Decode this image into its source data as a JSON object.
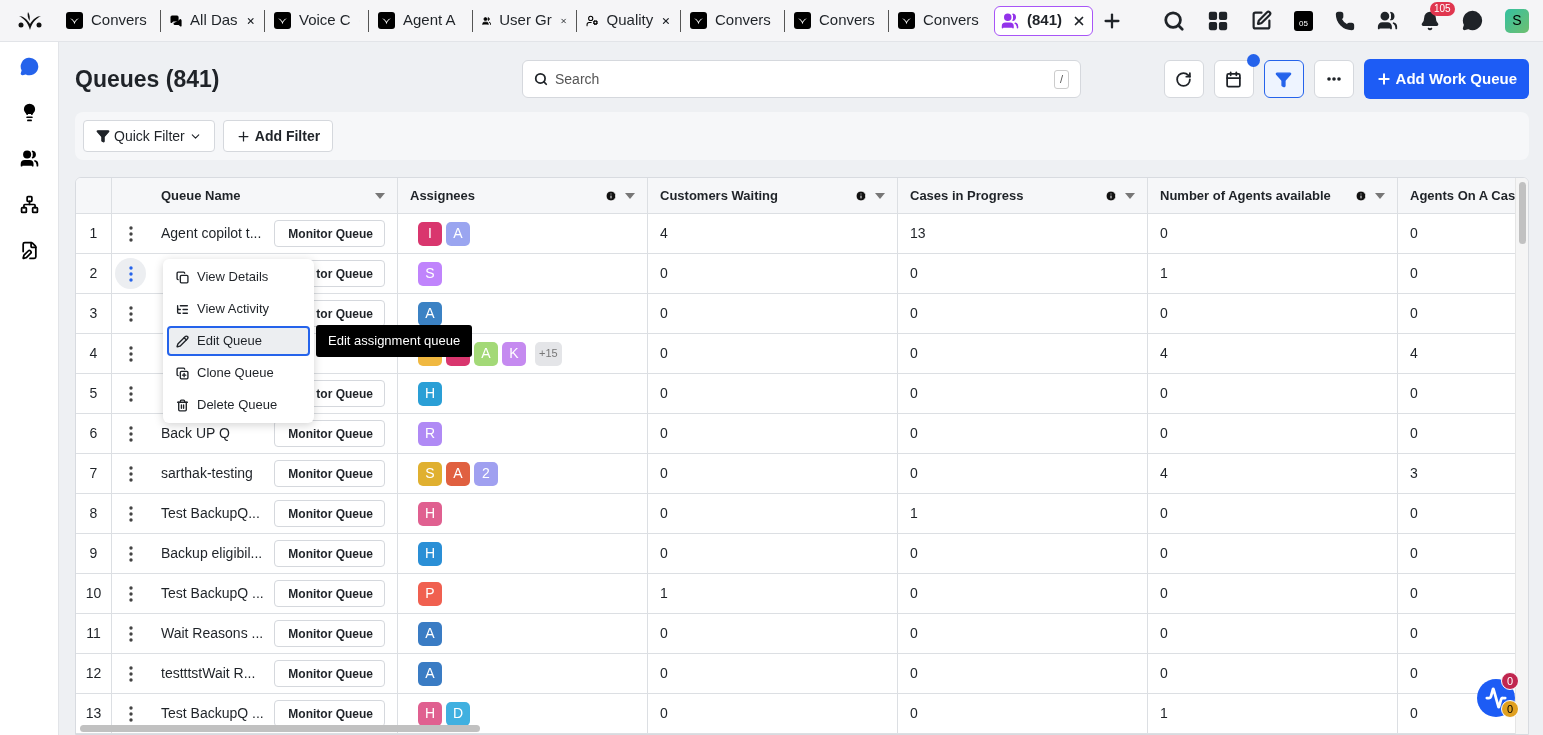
{
  "app_tabs": [
    {
      "label": "Convers",
      "kind": "app",
      "selected": false
    },
    {
      "label": "All Das",
      "kind": "chat",
      "selected": false
    },
    {
      "label": "Voice C",
      "kind": "app",
      "selected": false
    },
    {
      "label": "Agent A",
      "kind": "app",
      "selected": false
    },
    {
      "label": "User Gr",
      "kind": "users",
      "selected": false
    },
    {
      "label": "Quality",
      "kind": "agent",
      "selected": false
    },
    {
      "label": "Convers",
      "kind": "app",
      "selected": false
    },
    {
      "label": "Convers",
      "kind": "app",
      "selected": false
    },
    {
      "label": "Convers",
      "kind": "app",
      "selected": false
    },
    {
      "label": "(841)",
      "kind": "users",
      "selected": true
    }
  ],
  "top_bar": {
    "calendar_day": "05",
    "notification_count": "105",
    "user_initial": "S"
  },
  "sidebar": {
    "items": [
      {
        "selected": true
      },
      {
        "selected": false
      },
      {
        "selected": false
      },
      {
        "selected": false
      },
      {
        "selected": false
      }
    ]
  },
  "page": {
    "title": "Queues (841)",
    "search": {
      "placeholder": "Search",
      "shortcut": "/"
    },
    "calendar_dot": true,
    "filter_active": true,
    "add_button": "Add Work Queue"
  },
  "filters": [
    {
      "label": "Quick Filter",
      "kind": "dropdown"
    },
    {
      "label": "Add Filter",
      "kind": "add"
    }
  ],
  "table": {
    "columns": [
      {
        "label": "Queue Name",
        "info": false
      },
      {
        "label": "Assignees",
        "info": true
      },
      {
        "label": "Customers Waiting",
        "info": true
      },
      {
        "label": "Cases in Progress",
        "info": true
      },
      {
        "label": "Number of Agents available",
        "info": true
      },
      {
        "label": "Agents On A Cas",
        "info": false
      }
    ],
    "rows": [
      {
        "index": "1",
        "name": "Agent copilot t...",
        "monitor": "Monitor Queue",
        "menu_open": false,
        "assignees": [
          {
            "letter": "I",
            "color": "#d9366e"
          },
          {
            "letter": "A",
            "color": "#9aa5f0"
          }
        ],
        "values": [
          "4",
          "13",
          "0",
          "0"
        ]
      },
      {
        "index": "2",
        "monitor": "tor Queue",
        "menu_open": true,
        "assignees": [
          {
            "letter": "S",
            "color": "#c084fc"
          }
        ],
        "values": [
          "0",
          "0",
          "1",
          "0"
        ]
      },
      {
        "index": "3",
        "monitor": "tor Queue",
        "menu_open": false,
        "assignees": [
          {
            "letter": "A",
            "color": "#3b82c4"
          }
        ],
        "values": [
          "0",
          "0",
          "0",
          "0"
        ]
      },
      {
        "index": "4",
        "menu_open": false,
        "assignees": [
          {
            "color": "#f0b840"
          },
          {
            "color": "#d9366e"
          },
          {
            "letter": "A",
            "color": "#a3d977"
          },
          {
            "letter": "K",
            "color": "#c58af0"
          }
        ],
        "more": "+15",
        "values": [
          "0",
          "0",
          "4",
          "4"
        ]
      },
      {
        "index": "5",
        "monitor": "tor Queue",
        "menu_open": false,
        "assignees": [
          {
            "letter": "H",
            "color": "#2a9fd6"
          }
        ],
        "values": [
          "0",
          "0",
          "0",
          "0"
        ]
      },
      {
        "index": "6",
        "name": "Back UP Q",
        "monitor": "Monitor Queue",
        "menu_open": false,
        "assignees": [
          {
            "letter": "R",
            "color": "#b08af5"
          }
        ],
        "values": [
          "0",
          "0",
          "0",
          "0"
        ]
      },
      {
        "index": "7",
        "name": "sarthak-testing",
        "monitor": "Monitor Queue",
        "menu_open": false,
        "assignees": [
          {
            "letter": "S",
            "color": "#e0b030"
          },
          {
            "letter": "A",
            "color": "#e06040"
          },
          {
            "letter": "2",
            "color": "#a0a0f0"
          }
        ],
        "values": [
          "0",
          "0",
          "4",
          "3"
        ]
      },
      {
        "index": "8",
        "name": "Test BackupQ...",
        "monitor": "Monitor Queue",
        "menu_open": false,
        "assignees": [
          {
            "letter": "H",
            "color": "#e06090"
          }
        ],
        "values": [
          "0",
          "1",
          "0",
          "0"
        ]
      },
      {
        "index": "9",
        "name": "Backup eligibil...",
        "monitor": "Monitor Queue",
        "menu_open": false,
        "assignees": [
          {
            "letter": "H",
            "color": "#2a8fd6"
          }
        ],
        "values": [
          "0",
          "0",
          "0",
          "0"
        ]
      },
      {
        "index": "10",
        "name": "Test BackupQ ...",
        "monitor": "Monitor Queue",
        "menu_open": false,
        "assignees": [
          {
            "letter": "P",
            "color": "#f06050"
          }
        ],
        "values": [
          "1",
          "0",
          "0",
          "0"
        ]
      },
      {
        "index": "11",
        "name": "Wait Reasons ...",
        "monitor": "Monitor Queue",
        "menu_open": false,
        "assignees": [
          {
            "letter": "A",
            "color": "#3a7cc4"
          }
        ],
        "values": [
          "0",
          "0",
          "0",
          "0"
        ]
      },
      {
        "index": "12",
        "name": "testttstWait R...",
        "monitor": "Monitor Queue",
        "menu_open": false,
        "assignees": [
          {
            "letter": "A",
            "color": "#3a7cc4"
          }
        ],
        "values": [
          "0",
          "0",
          "0",
          "0"
        ]
      },
      {
        "index": "13",
        "name": "Test BackupQ ...",
        "monitor": "Monitor Queue",
        "menu_open": false,
        "assignees": [
          {
            "letter": "H",
            "color": "#e06090"
          },
          {
            "letter": "D",
            "color": "#40b0e0"
          }
        ],
        "values": [
          "0",
          "0",
          "1",
          "0"
        ]
      }
    ]
  },
  "row_menu": {
    "items": [
      {
        "label": "View Details",
        "selected": false
      },
      {
        "label": "View Activity",
        "selected": false
      },
      {
        "label": "Edit Queue",
        "selected": true
      },
      {
        "label": "Clone Queue",
        "selected": false
      },
      {
        "label": "Delete Queue",
        "selected": false
      }
    ],
    "tooltip": "Edit assignment queue"
  },
  "widget": {
    "badges": [
      {
        "count": "0",
        "color": "#c0264f"
      },
      {
        "count": "0",
        "color": "#e0a020"
      }
    ]
  }
}
